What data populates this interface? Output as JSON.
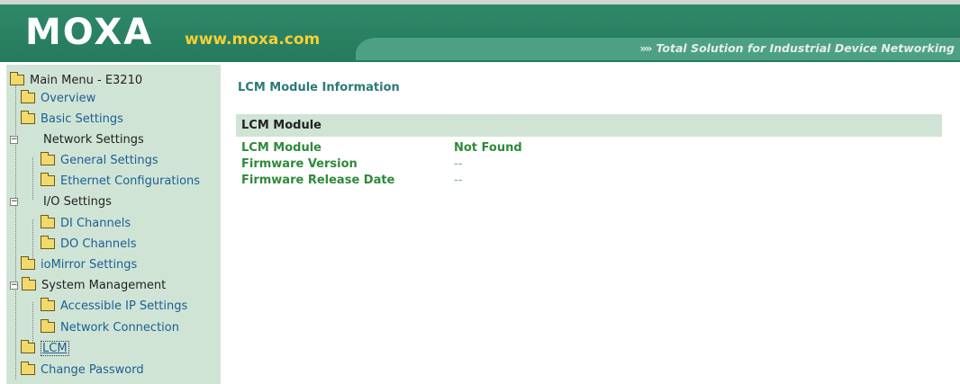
{
  "header": {
    "logo": "MOXA",
    "url": "www.moxa.com",
    "tagline": "Total Solution for Industrial Device Networking",
    "colors": {
      "band": "#257a5c",
      "url": "#f7cf33"
    }
  },
  "sidebar": {
    "root": "Main Menu - E3210",
    "items": [
      {
        "label": "Overview"
      },
      {
        "label": "Basic Settings"
      },
      {
        "label": "Network Settings"
      },
      {
        "label": "General Settings"
      },
      {
        "label": "Ethernet Configurations"
      },
      {
        "label": "I/O Settings"
      },
      {
        "label": "DI Channels"
      },
      {
        "label": "DO Channels"
      },
      {
        "label": "ioMirror Settings"
      },
      {
        "label": "System Management"
      },
      {
        "label": "Accessible IP Settings"
      },
      {
        "label": "Network Connection"
      },
      {
        "label": "LCM"
      },
      {
        "label": "Change Password"
      }
    ]
  },
  "main": {
    "title": "LCM Module Information",
    "section": "LCM Module",
    "rows": [
      {
        "label": "LCM Module",
        "value": "Not Found"
      },
      {
        "label": "Firmware Version",
        "value": "--"
      },
      {
        "label": "Firmware Release Date",
        "value": "--"
      }
    ]
  }
}
